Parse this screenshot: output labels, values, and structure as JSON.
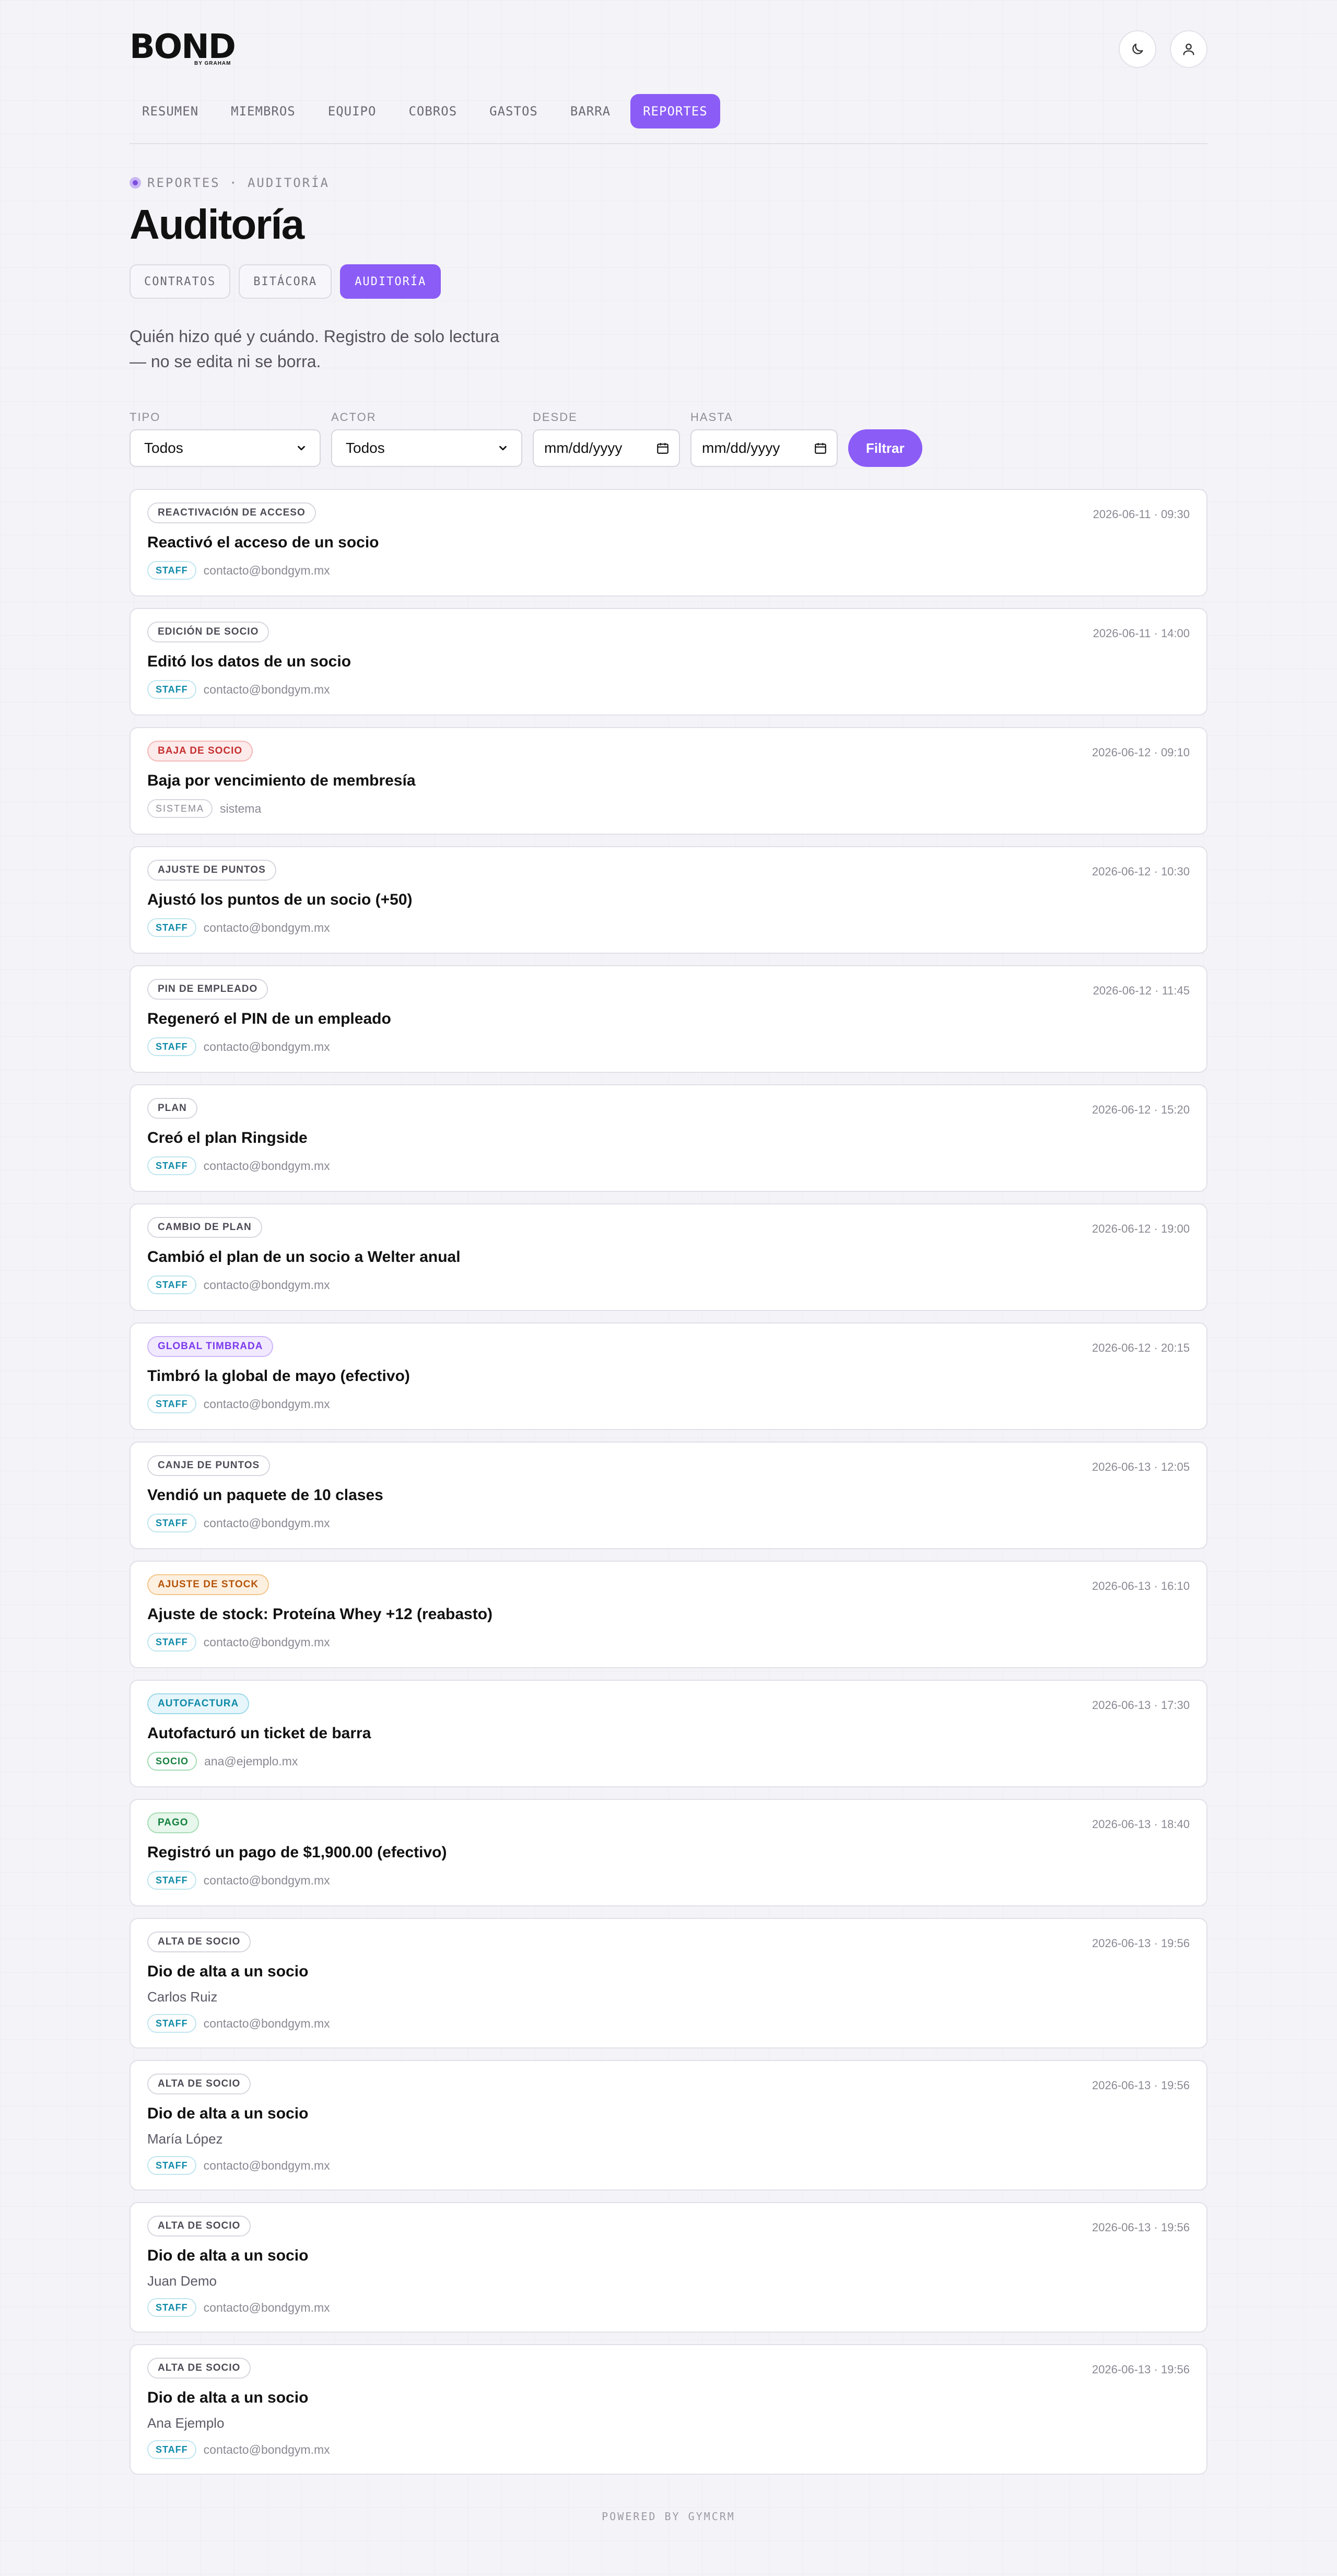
{
  "brand": {
    "logo": "BOND",
    "logo_sub": "BY GRAHAM"
  },
  "header": {
    "theme_icon": "moon-icon",
    "user_icon": "user-icon"
  },
  "nav": {
    "items": [
      {
        "label": "RESUMEN",
        "active": false
      },
      {
        "label": "MIEMBROS",
        "active": false
      },
      {
        "label": "EQUIPO",
        "active": false
      },
      {
        "label": "COBROS",
        "active": false
      },
      {
        "label": "GASTOS",
        "active": false
      },
      {
        "label": "BARRA",
        "active": false
      },
      {
        "label": "REPORTES",
        "active": true
      }
    ]
  },
  "breadcrumb": "REPORTES · AUDITORÍA",
  "page_title": "Auditoría",
  "subtabs": [
    {
      "label": "CONTRATOS",
      "active": false
    },
    {
      "label": "BITÁCORA",
      "active": false
    },
    {
      "label": "AUDITORÍA",
      "active": true
    }
  ],
  "description": "Quién hizo qué y cuándo. Registro de solo lectura — no se edita ni se borra.",
  "filters": {
    "tipo_label": "TIPO",
    "tipo_value": "Todos",
    "actor_label": "ACTOR",
    "actor_value": "Todos",
    "desde_label": "DESDE",
    "desde_value": "mm/dd/yyyy",
    "hasta_label": "HASTA",
    "hasta_value": "mm/dd/yyyy",
    "button": "Filtrar"
  },
  "entries": [
    {
      "tag": "REACTIVACIÓN DE ACCESO",
      "tone": "neutral",
      "timestamp": "2026-06-11 · 09:30",
      "title": "Reactivó el acceso de un socio",
      "subject": "",
      "role": "STAFF",
      "actor": "contacto@bondgym.mx"
    },
    {
      "tag": "EDICIÓN DE SOCIO",
      "tone": "neutral",
      "timestamp": "2026-06-11 · 14:00",
      "title": "Editó los datos de un socio",
      "subject": "",
      "role": "STAFF",
      "actor": "contacto@bondgym.mx"
    },
    {
      "tag": "BAJA DE SOCIO",
      "tone": "red",
      "timestamp": "2026-06-12 · 09:10",
      "title": "Baja por vencimiento de membresía",
      "subject": "",
      "role": "SISTEMA",
      "actor": "sistema"
    },
    {
      "tag": "AJUSTE DE PUNTOS",
      "tone": "neutral",
      "timestamp": "2026-06-12 · 10:30",
      "title": "Ajustó los puntos de un socio (+50)",
      "subject": "",
      "role": "STAFF",
      "actor": "contacto@bondgym.mx"
    },
    {
      "tag": "PIN DE EMPLEADO",
      "tone": "neutral",
      "timestamp": "2026-06-12 · 11:45",
      "title": "Regeneró el PIN de un empleado",
      "subject": "",
      "role": "STAFF",
      "actor": "contacto@bondgym.mx"
    },
    {
      "tag": "PLAN",
      "tone": "neutral",
      "timestamp": "2026-06-12 · 15:20",
      "title": "Creó el plan Ringside",
      "subject": "",
      "role": "STAFF",
      "actor": "contacto@bondgym.mx"
    },
    {
      "tag": "CAMBIO DE PLAN",
      "tone": "neutral",
      "timestamp": "2026-06-12 · 19:00",
      "title": "Cambió el plan de un socio a Welter anual",
      "subject": "",
      "role": "STAFF",
      "actor": "contacto@bondgym.mx"
    },
    {
      "tag": "GLOBAL TIMBRADA",
      "tone": "purple",
      "timestamp": "2026-06-12 · 20:15",
      "title": "Timbró la global de mayo (efectivo)",
      "subject": "",
      "role": "STAFF",
      "actor": "contacto@bondgym.mx"
    },
    {
      "tag": "CANJE DE PUNTOS",
      "tone": "neutral",
      "timestamp": "2026-06-13 · 12:05",
      "title": "Vendió un paquete de 10 clases",
      "subject": "",
      "role": "STAFF",
      "actor": "contacto@bondgym.mx"
    },
    {
      "tag": "AJUSTE DE STOCK",
      "tone": "orange",
      "timestamp": "2026-06-13 · 16:10",
      "title": "Ajuste de stock: Proteína Whey +12 (reabasto)",
      "subject": "",
      "role": "STAFF",
      "actor": "contacto@bondgym.mx"
    },
    {
      "tag": "AUTOFACTURA",
      "tone": "cyan",
      "timestamp": "2026-06-13 · 17:30",
      "title": "Autofacturó un ticket de barra",
      "subject": "",
      "role": "SOCIO",
      "actor": "ana@ejemplo.mx"
    },
    {
      "tag": "PAGO",
      "tone": "green",
      "timestamp": "2026-06-13 · 18:40",
      "title": "Registró un pago de $1,900.00 (efectivo)",
      "subject": "",
      "role": "STAFF",
      "actor": "contacto@bondgym.mx"
    },
    {
      "tag": "ALTA DE SOCIO",
      "tone": "neutral",
      "timestamp": "2026-06-13 · 19:56",
      "title": "Dio de alta a un socio",
      "subject": "Carlos Ruiz",
      "role": "STAFF",
      "actor": "contacto@bondgym.mx"
    },
    {
      "tag": "ALTA DE SOCIO",
      "tone": "neutral",
      "timestamp": "2026-06-13 · 19:56",
      "title": "Dio de alta a un socio",
      "subject": "María López",
      "role": "STAFF",
      "actor": "contacto@bondgym.mx"
    },
    {
      "tag": "ALTA DE SOCIO",
      "tone": "neutral",
      "timestamp": "2026-06-13 · 19:56",
      "title": "Dio de alta a un socio",
      "subject": "Juan Demo",
      "role": "STAFF",
      "actor": "contacto@bondgym.mx"
    },
    {
      "tag": "ALTA DE SOCIO",
      "tone": "neutral",
      "timestamp": "2026-06-13 · 19:56",
      "title": "Dio de alta a un socio",
      "subject": "Ana Ejemplo",
      "role": "STAFF",
      "actor": "contacto@bondgym.mx"
    }
  ],
  "footer": "POWERED BY GYMCRM",
  "colors": {
    "accent": "#8b5cf6",
    "background": "#f4f3f7",
    "staff": "#0e8aa8",
    "socio": "#15803d",
    "baja": "#c53030"
  }
}
